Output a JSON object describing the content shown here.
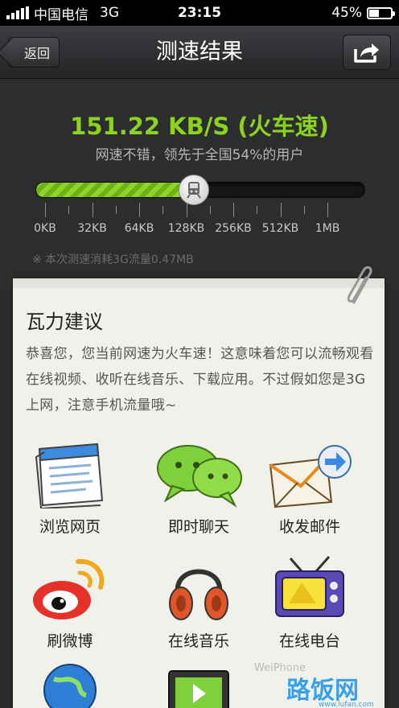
{
  "status_bar": {
    "carrier": "中国电信",
    "network": "3G",
    "time": "23:15",
    "battery": "45%",
    "battery_level": 0.45
  },
  "nav": {
    "back_label": "返回",
    "title": "测速结果"
  },
  "result": {
    "speed": "151.22 KB/S (火车速)",
    "summary": "网速不错，领先于全国54%的用户",
    "scale_labels": [
      "0KB",
      "32KB",
      "64KB",
      "128KB",
      "256KB",
      "512KB",
      "1MB"
    ],
    "progress_fraction": 0.48,
    "usage_note": "※ 本次测速消耗3G流量0.47MB",
    "accent_color": "#8cd21e"
  },
  "advice": {
    "title": "瓦力建议",
    "text": "恭喜您，您当前网速为火车速！这意味着您可以流畅观看在线视频、收听在线音乐、下载应用。不过假如您是3G上网，注意手机流量哦~",
    "features": [
      {
        "label": "浏览网页",
        "icon": "browser-icon"
      },
      {
        "label": "即时聊天",
        "icon": "chat-bubbles-icon"
      },
      {
        "label": "收发邮件",
        "icon": "envelope-icon"
      },
      {
        "label": "刷微博",
        "icon": "weibo-icon"
      },
      {
        "label": "在线音乐",
        "icon": "headphones-icon"
      },
      {
        "label": "在线电台",
        "icon": "radio-tv-icon"
      }
    ]
  },
  "watermark": {
    "text1": "WeiPhone",
    "text2": "路饭网",
    "text3": "www.lufan.com"
  }
}
